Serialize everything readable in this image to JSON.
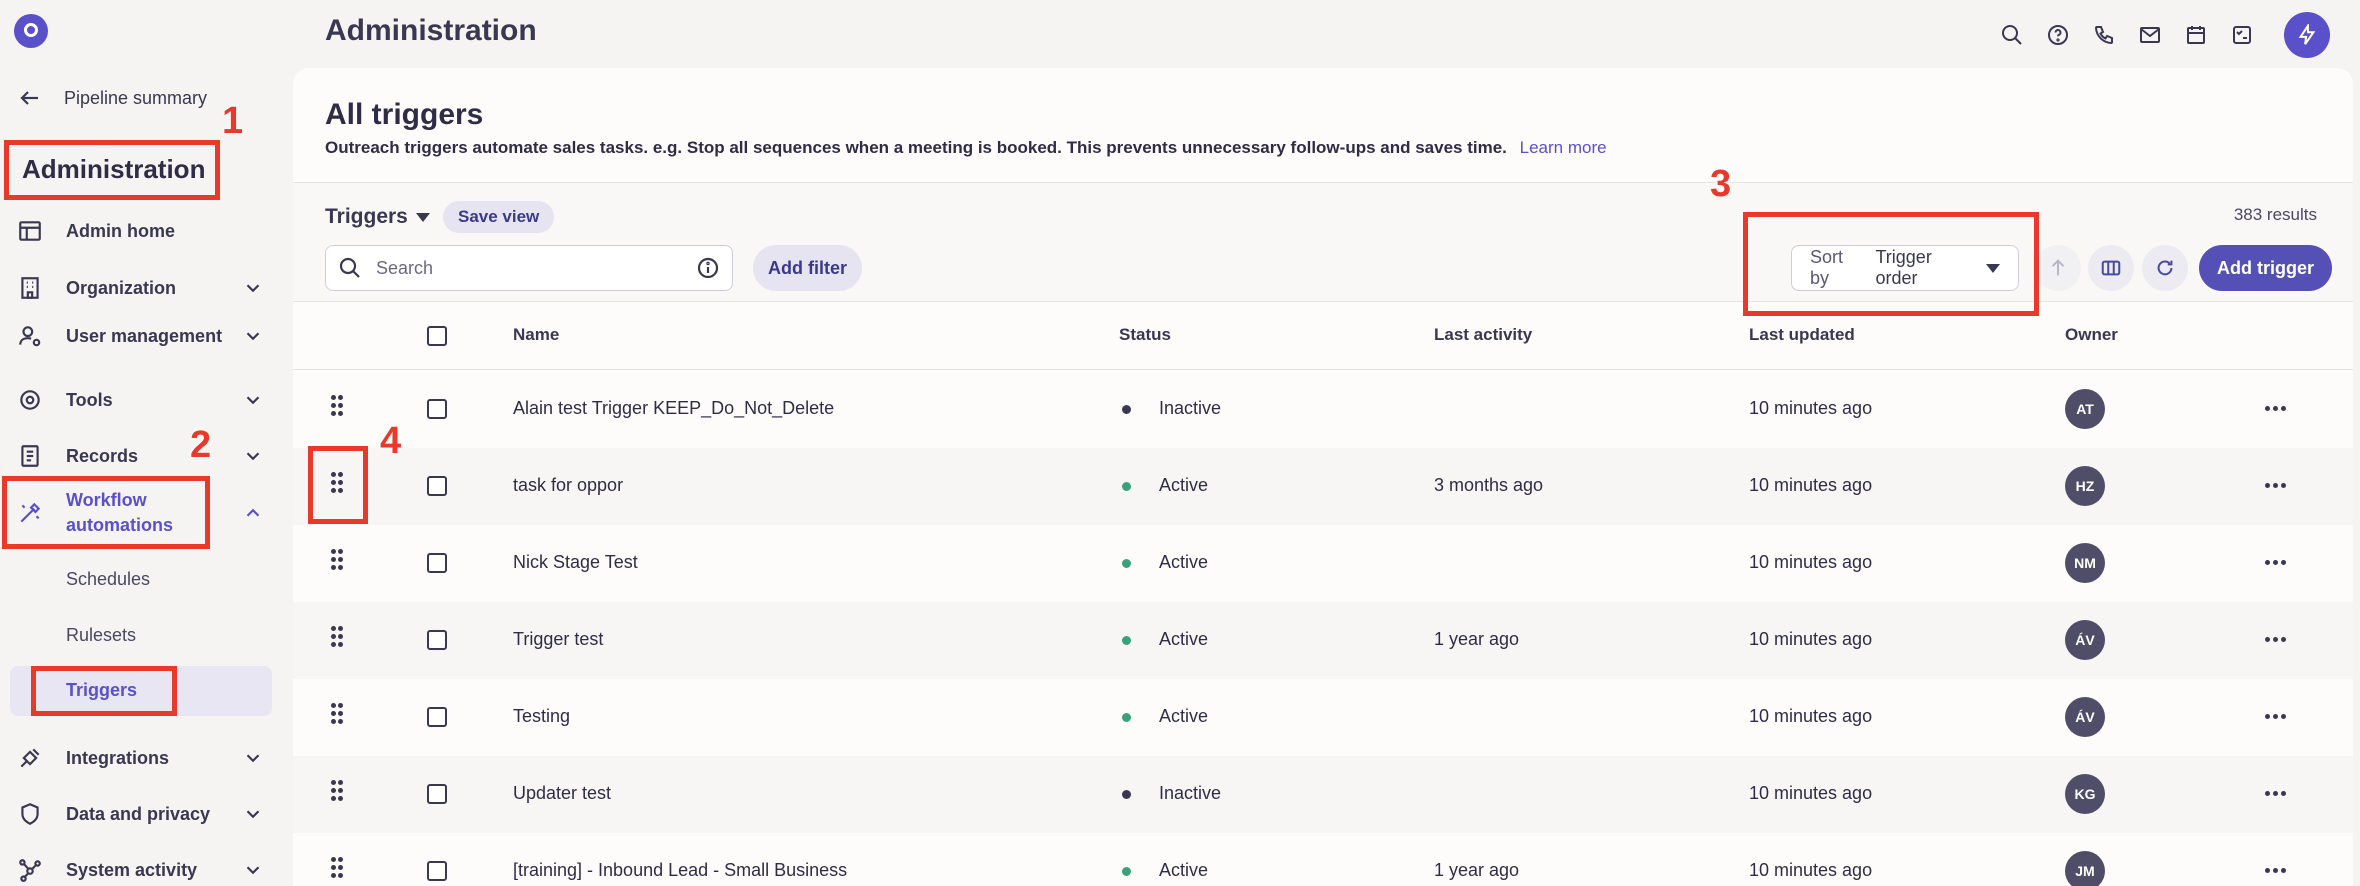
{
  "topbar": {
    "title": "Administration",
    "icons": [
      "search-icon",
      "help-icon",
      "phone-icon",
      "mail-icon",
      "calendar-icon",
      "tasks-icon",
      "bolt-icon"
    ]
  },
  "sidebar": {
    "back_label": "Pipeline summary",
    "heading": "Administration",
    "items": [
      {
        "label": "Admin home",
        "icon": "layout-icon"
      },
      {
        "label": "Organization",
        "icon": "building-icon"
      },
      {
        "label": "User management",
        "icon": "user-gear-icon"
      },
      {
        "label": "Tools",
        "icon": "tools-icon"
      },
      {
        "label": "Records",
        "icon": "records-icon"
      },
      {
        "label": "Workflow automations",
        "icon": "workflow-icon"
      },
      {
        "label": "Integrations",
        "icon": "plug-icon"
      },
      {
        "label": "Data and privacy",
        "icon": "shield-icon"
      },
      {
        "label": "System activity",
        "icon": "network-icon"
      }
    ],
    "sub_items": [
      "Schedules",
      "Rulesets",
      "Triggers"
    ]
  },
  "annotations": [
    "1",
    "2",
    "3",
    "4"
  ],
  "header": {
    "title": "All triggers",
    "description": "Outreach triggers automate sales tasks. e.g. Stop all sequences when a meeting is booked. This prevents unnecessary follow-ups and saves time.",
    "learn_more": "Learn more"
  },
  "toolbar": {
    "view_name": "Triggers",
    "save_view": "Save view",
    "results": "383 results",
    "search_placeholder": "Search",
    "add_filter": "Add filter",
    "sort_label": "Sort by",
    "sort_value": "Trigger order",
    "add_trigger": "Add trigger"
  },
  "table": {
    "columns": [
      "Name",
      "Status",
      "Last activity",
      "Last updated",
      "Owner"
    ],
    "rows": [
      {
        "name": "Alain test Trigger KEEP_Do_Not_Delete",
        "status": "Inactive",
        "last_activity": "",
        "last_updated": "10 minutes ago",
        "owner": "AT"
      },
      {
        "name": "task for oppor",
        "status": "Active",
        "last_activity": "3 months ago",
        "last_updated": "10 minutes ago",
        "owner": "HZ"
      },
      {
        "name": "Nick Stage Test",
        "status": "Active",
        "last_activity": "",
        "last_updated": "10 minutes ago",
        "owner": "NM"
      },
      {
        "name": "Trigger test",
        "status": "Active",
        "last_activity": "1 year ago",
        "last_updated": "10 minutes ago",
        "owner": "ÁV"
      },
      {
        "name": "Testing",
        "status": "Active",
        "last_activity": "",
        "last_updated": "10 minutes ago",
        "owner": "ÁV"
      },
      {
        "name": "Updater test",
        "status": "Inactive",
        "last_activity": "",
        "last_updated": "10 minutes ago",
        "owner": "KG"
      },
      {
        "name": "[training] - Inbound Lead - Small Business",
        "status": "Active",
        "last_activity": "1 year ago",
        "last_updated": "10 minutes ago",
        "owner": "JM"
      }
    ]
  },
  "colors": {
    "accent": "#5a50c9",
    "active_dot": "#3aa17e",
    "inactive_dot": "#3a3850",
    "annotation": "#e8392a"
  }
}
